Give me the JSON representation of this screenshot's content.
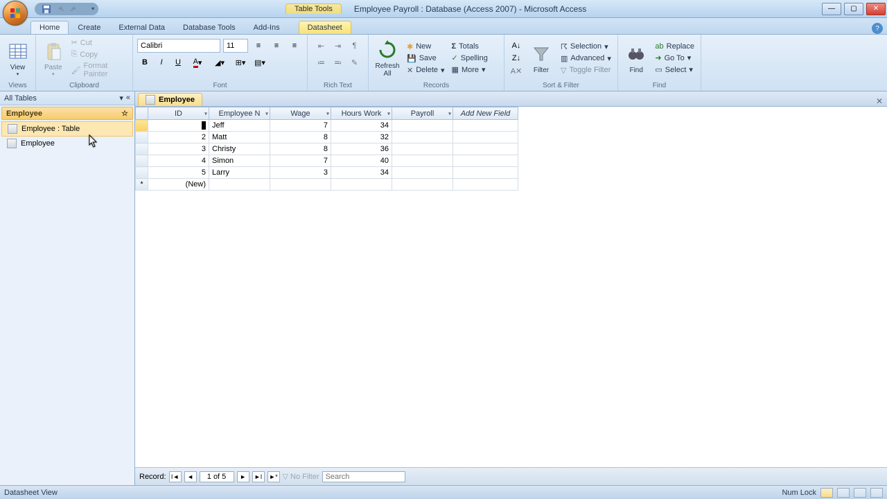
{
  "titlebar": {
    "contextual_label": "Table Tools",
    "title": "Employee Payroll : Database (Access 2007) - Microsoft Access"
  },
  "tabs": {
    "items": [
      "Home",
      "Create",
      "External Data",
      "Database Tools",
      "Add-Ins"
    ],
    "contextual": "Datasheet",
    "active": "Home"
  },
  "ribbon": {
    "views": {
      "label": "Views",
      "view": "View"
    },
    "clipboard": {
      "label": "Clipboard",
      "paste": "Paste",
      "cut": "Cut",
      "copy": "Copy",
      "fmt": "Format Painter"
    },
    "font": {
      "label": "Font",
      "name": "Calibri",
      "size": "11"
    },
    "richtext": {
      "label": "Rich Text"
    },
    "records": {
      "label": "Records",
      "refresh": "Refresh All",
      "new": "New",
      "save": "Save",
      "delete": "Delete",
      "totals": "Totals",
      "spelling": "Spelling",
      "more": "More"
    },
    "sortfilter": {
      "label": "Sort & Filter",
      "filter": "Filter",
      "selection": "Selection",
      "advanced": "Advanced",
      "toggle": "Toggle Filter"
    },
    "find": {
      "label": "Find",
      "find": "Find",
      "replace": "Replace",
      "goto": "Go To",
      "select": "Select"
    }
  },
  "nav": {
    "header": "All Tables",
    "group": "Employee",
    "item1": "Employee : Table",
    "item2": "Employee"
  },
  "doc": {
    "tab": "Employee",
    "columns": [
      "ID",
      "Employee N",
      "Wage",
      "Hours Work",
      "Payroll"
    ],
    "add_field": "Add New Field",
    "rows": [
      {
        "id": "",
        "name": "Jeff",
        "wage": "7",
        "hours": "34",
        "payroll": ""
      },
      {
        "id": "2",
        "name": "Matt",
        "wage": "8",
        "hours": "32",
        "payroll": ""
      },
      {
        "id": "3",
        "name": "Christy",
        "wage": "8",
        "hours": "36",
        "payroll": ""
      },
      {
        "id": "4",
        "name": "Simon",
        "wage": "7",
        "hours": "40",
        "payroll": ""
      },
      {
        "id": "5",
        "name": "Larry",
        "wage": "3",
        "hours": "34",
        "payroll": ""
      }
    ],
    "new_row": "(New)",
    "new_row_marker": "*"
  },
  "recnav": {
    "label": "Record:",
    "pos": "1 of 5",
    "nofilter": "No Filter",
    "search": "Search"
  },
  "status": {
    "left": "Datasheet View",
    "numlock": "Num Lock"
  }
}
